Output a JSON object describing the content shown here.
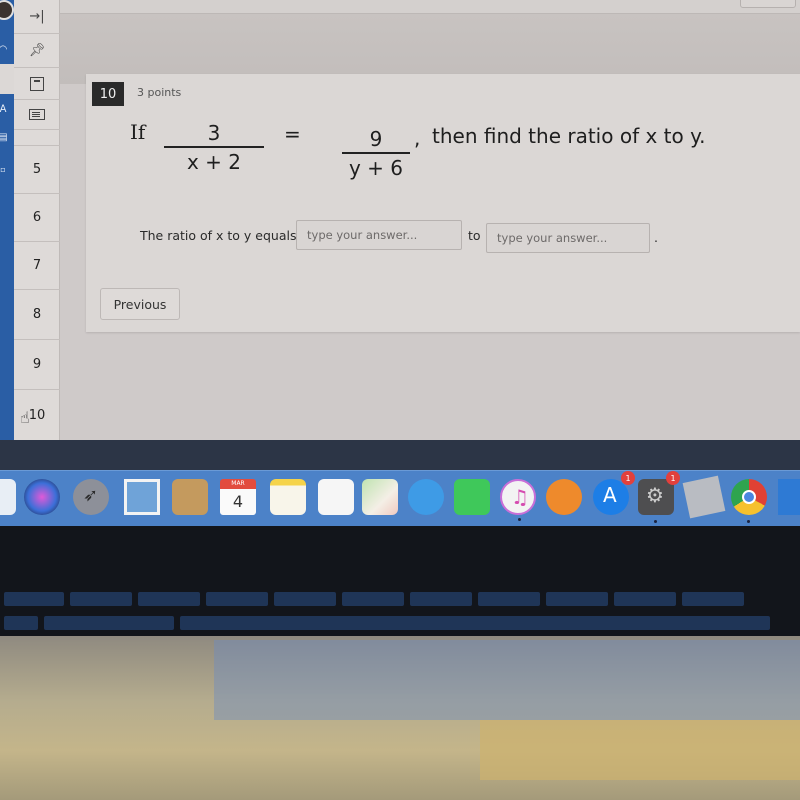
{
  "question_nav": {
    "collapse_icon": "collapse-right-icon",
    "pin_icon": "pin-icon",
    "items": [
      "5",
      "6",
      "7",
      "8",
      "9",
      "10"
    ]
  },
  "question": {
    "number": "10",
    "points": "3 points",
    "stem": {
      "if": "If",
      "frac1_num": "3",
      "frac1_den": "x + 2",
      "equals": "=",
      "frac2_num": "9",
      "frac2_den": "y + 6",
      "comma": ",",
      "tail": "then find the ratio of x to y."
    },
    "answer": {
      "label": "The ratio of x to y equals",
      "input1_placeholder": "type your answer...",
      "input1_value": "",
      "to": "to",
      "input2_placeholder": "type your answer...",
      "input2_value": "",
      "period": "."
    },
    "previous_label": "Previous"
  },
  "dock": {
    "calendar_month": "MAR",
    "calendar_day": "4",
    "app_store_badge": "1",
    "system_prefs_badge": "1",
    "items": [
      "finder",
      "siri",
      "launchpad",
      "mail",
      "contacts",
      "calendar",
      "notes",
      "reminders",
      "maps",
      "messages",
      "facetime",
      "itunes",
      "ibooks",
      "app-store",
      "system-preferences",
      "roblox",
      "chrome",
      "partial-app"
    ]
  }
}
